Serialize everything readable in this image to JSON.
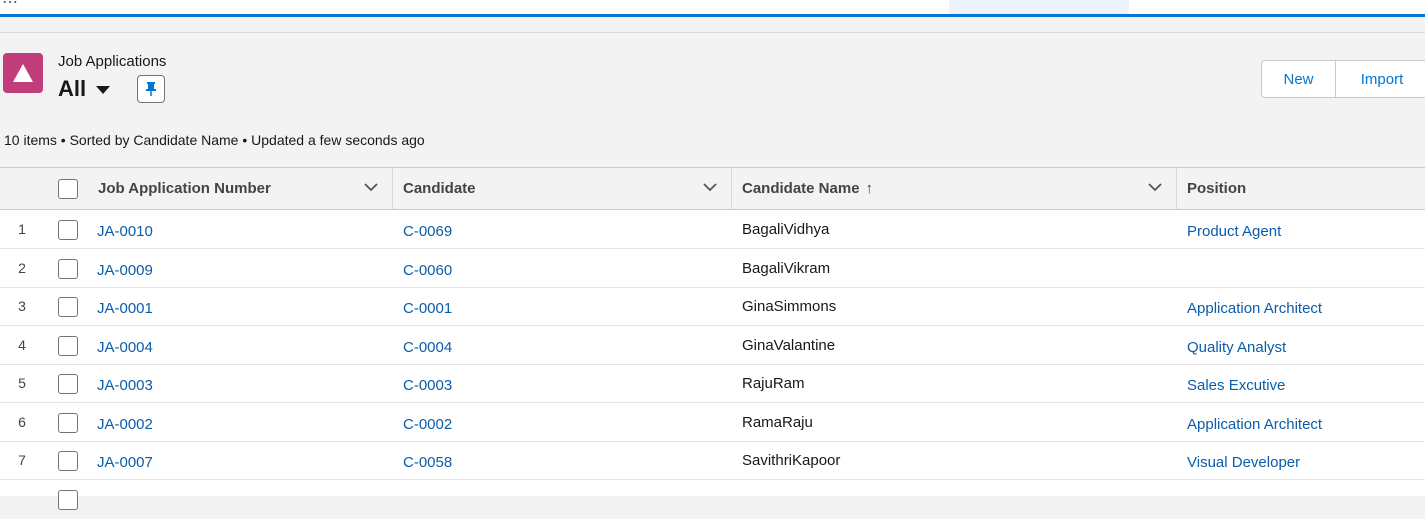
{
  "header": {
    "object_label": "Job Applications",
    "view_name": "All",
    "buttons": {
      "new": "New",
      "import": "Import"
    },
    "list_info": "10 items • Sorted by Candidate Name • Updated a few seconds ago",
    "icon_color": "#c23d7c"
  },
  "table": {
    "columns": {
      "number": "Job Application Number",
      "candidate": "Candidate",
      "candidate_name": "Candidate Name",
      "position": "Position"
    },
    "sort_indicator": "↑",
    "rows": [
      {
        "num": "1",
        "jan": "JA-0010",
        "candidate": "C-0069",
        "name": "BagaliVidhya",
        "position": "Product Agent"
      },
      {
        "num": "2",
        "jan": "JA-0009",
        "candidate": "C-0060",
        "name": "BagaliVikram",
        "position": ""
      },
      {
        "num": "3",
        "jan": "JA-0001",
        "candidate": "C-0001",
        "name": "GinaSimmons",
        "position": "Application Architect"
      },
      {
        "num": "4",
        "jan": "JA-0004",
        "candidate": "C-0004",
        "name": "GinaValantine",
        "position": "Quality Analyst"
      },
      {
        "num": "5",
        "jan": "JA-0003",
        "candidate": "C-0003",
        "name": "RajuRam",
        "position": "Sales Excutive"
      },
      {
        "num": "6",
        "jan": "JA-0002",
        "candidate": "C-0002",
        "name": "RamaRaju",
        "position": "Application Architect"
      },
      {
        "num": "7",
        "jan": "JA-0007",
        "candidate": "C-0058",
        "name": "SavithriKapoor",
        "position": "Visual Developer"
      }
    ]
  },
  "colors": {
    "accent": "#0176d3",
    "link": "#0b5cab"
  }
}
